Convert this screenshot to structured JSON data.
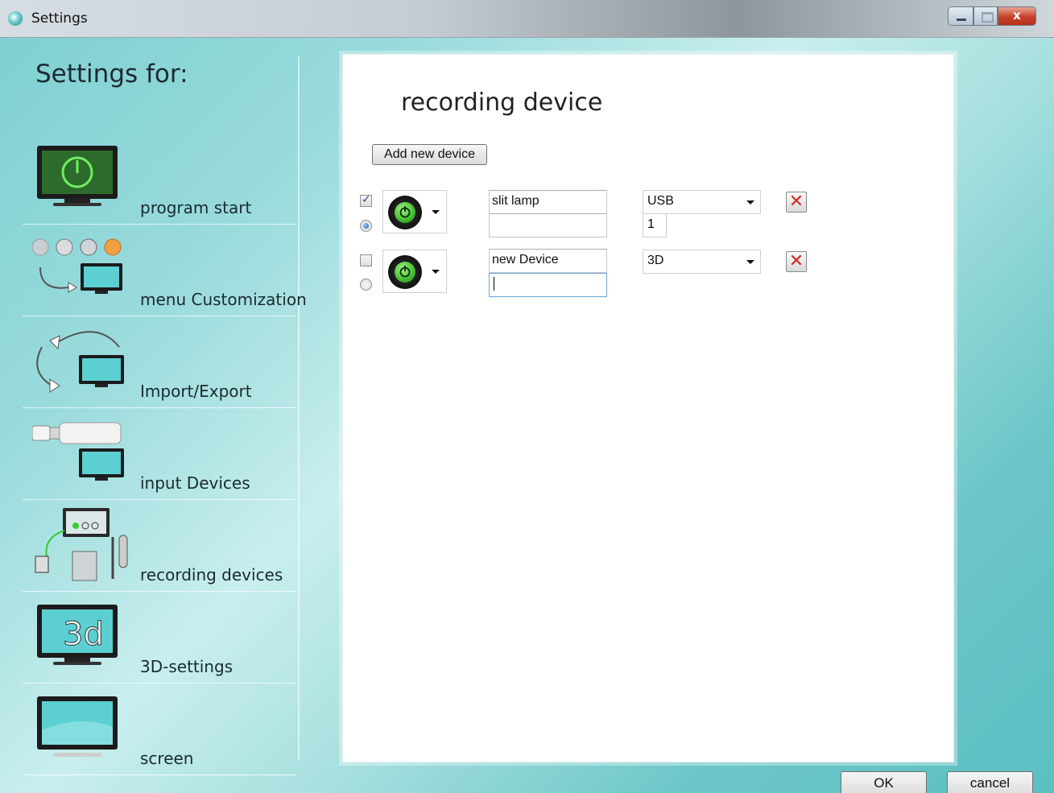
{
  "window": {
    "title": "Settings",
    "close_label": "x"
  },
  "sidebar": {
    "title": "Settings for:",
    "items": [
      {
        "label": "program start",
        "icon": "monitor-power-icon"
      },
      {
        "label": "menu Customization",
        "icon": "menu-customization-icon"
      },
      {
        "label": "Import/Export",
        "icon": "import-export-icon"
      },
      {
        "label": "input Devices",
        "icon": "usb-stick-monitor-icon"
      },
      {
        "label": "recording devices",
        "icon": "slit-lamp-recording-icon"
      },
      {
        "label": "3D-settings",
        "icon": "monitor-3d-icon"
      },
      {
        "label": "screen",
        "icon": "monitor-screen-icon"
      }
    ]
  },
  "panel": {
    "title": "recording device",
    "add_button": "Add new device",
    "devices": [
      {
        "checked": true,
        "default": true,
        "icon": "power-icon",
        "name": "slit lamp",
        "name2": "",
        "type": "USB",
        "index": "1",
        "delete": "✕"
      },
      {
        "checked": false,
        "default": false,
        "icon": "power-icon",
        "name": "new Device",
        "name2": "",
        "type": "3D",
        "delete": "✕"
      }
    ]
  },
  "footer": {
    "ok": "OK",
    "cancel": "cancel"
  },
  "colors": {
    "accent": "#6cc6c8",
    "delete_red": "#d42a20",
    "power_green": "#4fc83a"
  }
}
